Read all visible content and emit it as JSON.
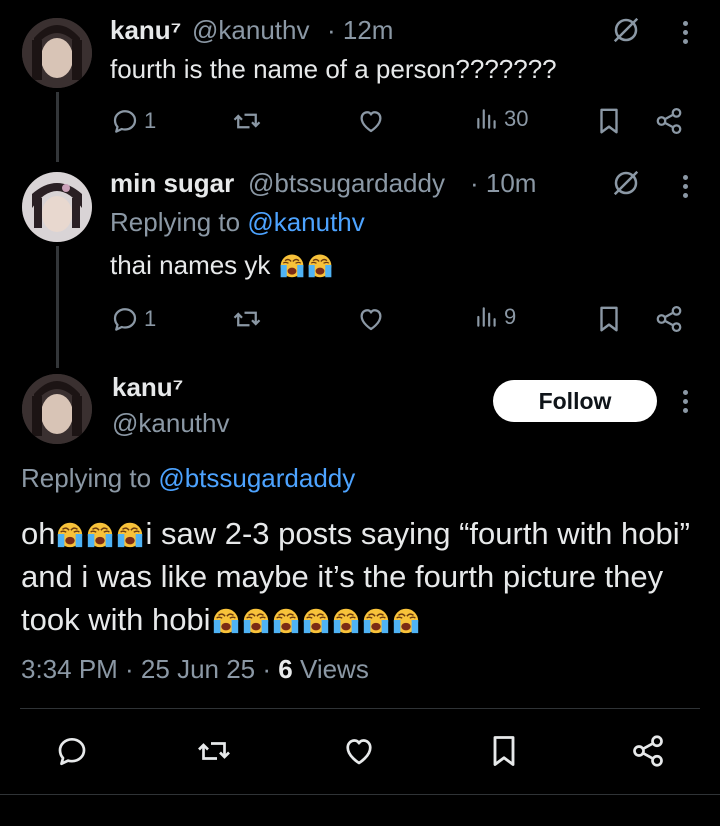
{
  "tweet1": {
    "display_name": "kanu⁷",
    "handle": "@kanuthv",
    "time": "· 12m",
    "text": "fourth is the name of a person???????",
    "replies": "1",
    "views": "30"
  },
  "tweet2": {
    "display_name": "min sugar",
    "handle": "@btssugardaddy",
    "time": "· 10m",
    "replying_label": "Replying to",
    "replying_handle": "@kanuthv",
    "text": "thai names yk",
    "replies": "1",
    "views": "9"
  },
  "main": {
    "display_name": "kanu⁷",
    "handle": "@kanuthv",
    "follow_label": "Follow",
    "replying_label": "Replying to",
    "replying_handle": "@btssugardaddy",
    "text_oh": "oh",
    "text_1": "i saw 2-3 posts saying “fourth with hobi” and i was like maybe it’s the fourth picture they took with hobi",
    "timestamp": "3:34 PM · 25 Jun 25 · ",
    "views_count": "6",
    "views_label": " Views"
  },
  "icons": [
    "grok-icon",
    "more-icon",
    "reply-icon",
    "retweet-icon",
    "like-icon",
    "views-icon",
    "bookmark-icon",
    "share-icon",
    "loudly-crying-emoji"
  ],
  "colors": {
    "background": "#000000",
    "text": "#e7e9ea",
    "secondary": "#8b98a5",
    "link": "#4da3ff"
  }
}
